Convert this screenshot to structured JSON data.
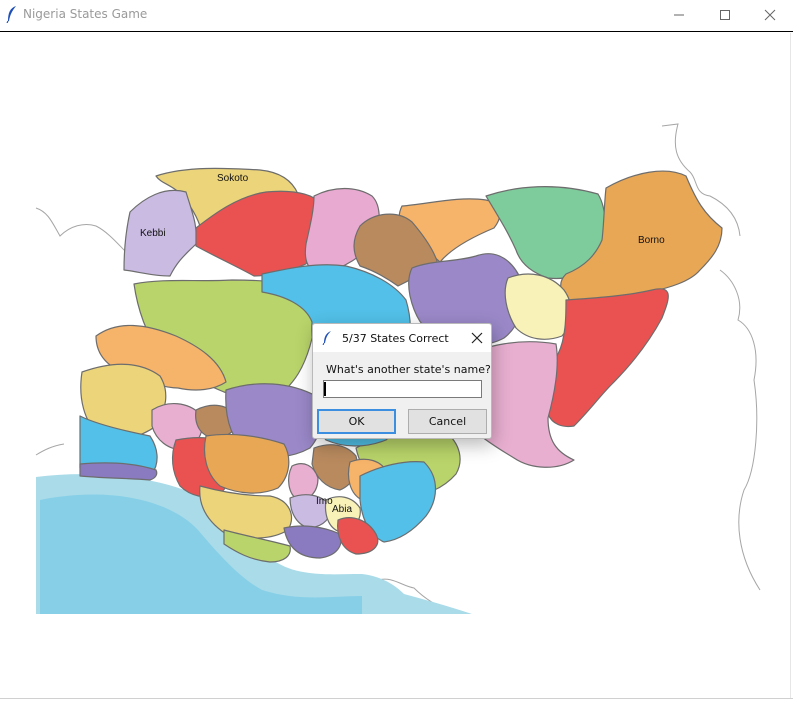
{
  "window": {
    "title": "Nigeria States Game",
    "controls": {
      "minimize": "minimize-icon",
      "maximize": "maximize-icon",
      "close": "close-icon"
    }
  },
  "map": {
    "labels": {
      "sokoto": "Sokoto",
      "kebbi": "Kebbi",
      "borno": "Borno",
      "imo": "Imo",
      "abia": "Abia"
    },
    "colors": {
      "ocean": "#a9dbe9",
      "ocean_deep": "#80cde6",
      "border": "#9e9e9e"
    }
  },
  "dialog": {
    "title": "5/37 States Correct",
    "prompt": "What's another state's name?",
    "input_value": "",
    "ok_label": "OK",
    "cancel_label": "Cancel"
  }
}
